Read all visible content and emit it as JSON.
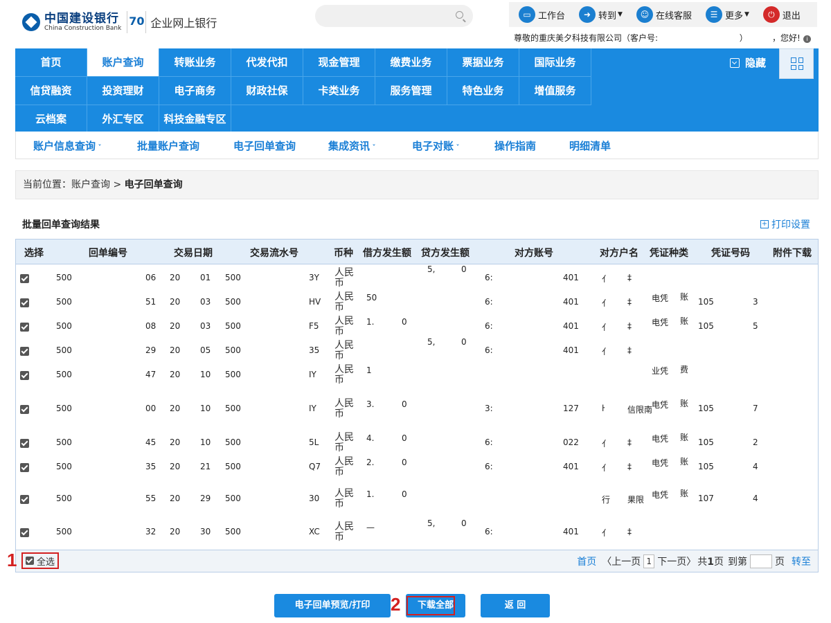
{
  "header": {
    "bank_name_cn": "中国建设银行",
    "bank_name_en": "China Construction Bank",
    "anniversary": "70",
    "site_name": "企业网上银行",
    "top_links": [
      {
        "label": "工作台",
        "icon": "monitor-icon"
      },
      {
        "label": "转到",
        "icon": "forward-icon",
        "dropdown": true
      },
      {
        "label": "在线客服",
        "icon": "user-icon"
      },
      {
        "label": "更多",
        "icon": "list-icon",
        "dropdown": true
      },
      {
        "label": "退出",
        "icon": "power-icon"
      }
    ],
    "greeting": "尊敬的重庆美夕科技有限公司（客户号:",
    "greeting_close": "）",
    "greeting_end": "，您好!"
  },
  "nav": {
    "rows": [
      [
        "首页",
        "账户查询",
        "转账业务",
        "代发代扣",
        "现金管理",
        "缴费业务",
        "票据业务",
        "国际业务"
      ],
      [
        "信贷融资",
        "投资理财",
        "电子商务",
        "财政社保",
        "卡类业务",
        "服务管理",
        "特色业务",
        "增值服务"
      ],
      [
        "云档案",
        "外汇专区",
        "科技金融专区"
      ]
    ],
    "active": "账户查询",
    "hide_label": "隐藏"
  },
  "subnav": [
    {
      "label": "账户信息查询",
      "dropdown": true
    },
    {
      "label": "批量账户查询",
      "dropdown": false
    },
    {
      "label": "电子回单查询",
      "dropdown": false
    },
    {
      "label": "集成资讯",
      "dropdown": true
    },
    {
      "label": "电子对账",
      "dropdown": true
    },
    {
      "label": "操作指南",
      "dropdown": false
    },
    {
      "label": "明细清单",
      "dropdown": false
    }
  ],
  "breadcrumb": {
    "prefix": "当前位置：账户查询 >",
    "current": "电子回单查询"
  },
  "results": {
    "title": "批量回单查询结果",
    "print_settings": "打印设置",
    "columns": [
      "选择",
      "回单编号",
      "交易日期",
      "交易流水号",
      "币种",
      "借方发生额",
      "贷方发生额",
      "对方账号",
      "对方户名",
      "凭证种类",
      "凭证号码",
      "附件下载"
    ],
    "rows": [
      {
        "id": "500",
        "id2": "06",
        "date": "20",
        "date2": "01",
        "serial": "500",
        "serial2": "3Y",
        "currency": "人民币",
        "debit": "",
        "debit2": "",
        "credit": "5,",
        "credit2": "0",
        "acct": "6:",
        "acct2": "401",
        "name": "亻",
        "name2": "‡",
        "vtype": "",
        "vtype2": "",
        "vno": "",
        "vno2": ""
      },
      {
        "id": "500",
        "id2": "51",
        "date": "20",
        "date2": "03",
        "serial": "500",
        "serial2": "HV",
        "currency": "人民币",
        "debit": "50",
        "debit2": "",
        "credit": "",
        "credit2": "",
        "acct": "6:",
        "acct2": "401",
        "name": "亻",
        "name2": "‡",
        "vtype": "电凭",
        "vtype2": "账",
        "vno": "105",
        "vno2": "3"
      },
      {
        "id": "500",
        "id2": "08",
        "date": "20",
        "date2": "03",
        "serial": "500",
        "serial2": "F5",
        "currency": "人民币",
        "debit": "1.",
        "debit2": "0",
        "credit": "",
        "credit2": "",
        "acct": "6:",
        "acct2": "401",
        "name": "亻",
        "name2": "‡",
        "vtype": "电凭",
        "vtype2": "账",
        "vno": "105",
        "vno2": "5"
      },
      {
        "id": "500",
        "id2": "29",
        "date": "20",
        "date2": "05",
        "serial": "500",
        "serial2": "35",
        "currency": "人民币",
        "debit": "",
        "debit2": "",
        "credit": "5,",
        "credit2": "0",
        "acct": "6:",
        "acct2": "401",
        "name": "亻",
        "name2": "‡",
        "vtype": "",
        "vtype2": "",
        "vno": "",
        "vno2": ""
      },
      {
        "id": "500",
        "id2": "47",
        "date": "20",
        "date2": "10",
        "serial": "500",
        "serial2": "IY",
        "currency": "人民币",
        "debit": "1",
        "debit2": "",
        "credit": "",
        "credit2": "",
        "acct": "",
        "acct2": "",
        "name": "",
        "name2": "",
        "vtype": "业凭",
        "vtype2": "费",
        "vno": "",
        "vno2": ""
      },
      {
        "id": "500",
        "id2": "00",
        "date": "20",
        "date2": "10",
        "serial": "500",
        "serial2": "IY",
        "currency": "人民币",
        "debit": "3.",
        "debit2": "0",
        "credit": "",
        "credit2": "",
        "acct": "3:",
        "acct2": "127",
        "name": "ŀ",
        "name2": "信限南",
        "vtype": "电凭",
        "vtype2": "账",
        "vno": "105",
        "vno2": "7"
      },
      {
        "id": "500",
        "id2": "45",
        "date": "20",
        "date2": "10",
        "serial": "500",
        "serial2": "5L",
        "currency": "人民币",
        "debit": "4.",
        "debit2": "0",
        "credit": "",
        "credit2": "",
        "acct": "6:",
        "acct2": "022",
        "name": "亻",
        "name2": "‡",
        "vtype": "电凭",
        "vtype2": "账",
        "vno": "105",
        "vno2": "2"
      },
      {
        "id": "500",
        "id2": "35",
        "date": "20",
        "date2": "21",
        "serial": "500",
        "serial2": "Q7",
        "currency": "人民币",
        "debit": "2.",
        "debit2": "0",
        "credit": "",
        "credit2": "",
        "acct": "6:",
        "acct2": "401",
        "name": "亻",
        "name2": "‡",
        "vtype": "电凭",
        "vtype2": "账",
        "vno": "105",
        "vno2": "4"
      },
      {
        "id": "500",
        "id2": "55",
        "date": "20",
        "date2": "29",
        "serial": "500",
        "serial2": "30",
        "currency": "人民币",
        "debit": "1.",
        "debit2": "0",
        "credit": "",
        "credit2": "",
        "acct": "",
        "acct2": "",
        "name": "行",
        "name2": "果限",
        "vtype": "电凭",
        "vtype2": "账",
        "vno": "107",
        "vno2": "4"
      },
      {
        "id": "500",
        "id2": "32",
        "date": "20",
        "date2": "30",
        "serial": "500",
        "serial2": "XC",
        "currency": "人民币",
        "debit": "—",
        "debit2": "",
        "credit": "5,",
        "credit2": "0",
        "acct": "6:",
        "acct2": "401",
        "name": "亻",
        "name2": "‡",
        "vtype": "",
        "vtype2": "",
        "vno": "",
        "vno2": ""
      }
    ],
    "select_all": "全选",
    "marker_1": "1",
    "marker_2": "2"
  },
  "pager": {
    "first": "首页",
    "prev": "〈上一页",
    "current": "1",
    "next": "下一页〉",
    "total_prefix": "共",
    "total": "1",
    "total_suffix": "页",
    "goto_prefix": "到第",
    "goto_suffix": "页",
    "goto": "转至"
  },
  "buttons": {
    "preview": "电子回单预览/打印",
    "download_all": "下载全部",
    "back": "返  回"
  }
}
